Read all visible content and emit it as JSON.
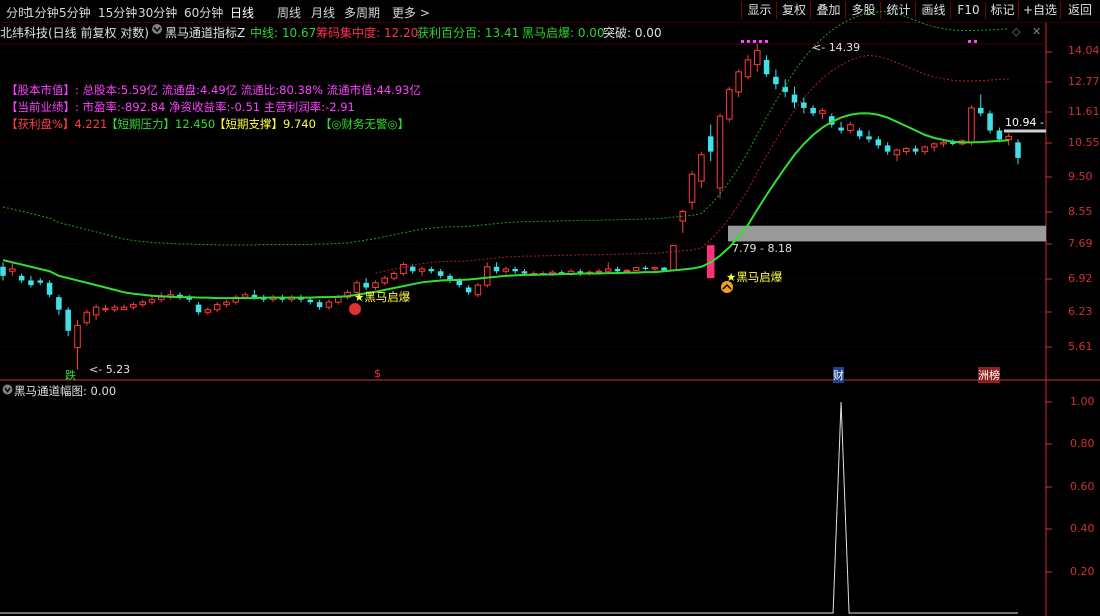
{
  "toolbar": {
    "tabs": [
      "分时",
      "1分钟",
      "5分钟",
      "15分钟",
      "30分钟",
      "60分钟",
      "日线",
      "周线",
      "月线",
      "多周期",
      "更多 >"
    ],
    "active_tab": "日线",
    "right_buttons": [
      "显示",
      "复权",
      "叠加",
      "多股",
      "统计",
      "画线",
      "F10",
      "标记",
      "+自选",
      "返回"
    ]
  },
  "header": {
    "stock": "北纬科技(日线 前复权 对数)",
    "indicator": "黑马通道指标Z",
    "fields": [
      {
        "label": "中线:",
        "value": "10.67",
        "color": "#30d030"
      },
      {
        "label": "筹码集中度:",
        "value": "12.20",
        "color": "#ff3050"
      },
      {
        "label": "获利百分百:",
        "value": "13.41",
        "color": "#30d030"
      },
      {
        "label": "黑马启爆:",
        "value": "0.00",
        "color": "#30d030"
      },
      {
        "label": "突破:",
        "value": "0.00",
        "color": "#e0e0e0"
      }
    ]
  },
  "info": {
    "line1": "【股本市值】: 总股本:5.59亿 流通盘:4.49亿 流通比:80.38% 流通市值:44.93亿",
    "line2": "【当前业绩】: 市盈率:-892.84 净资收益率:-0.51 主营利润率:-2.91",
    "line3_a": "【获利盘%】4.221",
    "line3_b": "【短期压力】12.450",
    "line3_c": "【短期支撑】9.740",
    "line3_d": "【◎财务无警◎】"
  },
  "annotations": {
    "high": "14.39",
    "low": "5.23",
    "range": "7.79 - 8.18",
    "current_tag": "10.94",
    "signal1": "黑马启爆",
    "signal2": "黑马启爆",
    "mark_die": "跌",
    "mark_s": "$",
    "mark_cai": "财",
    "mark_bang": "洲榜"
  },
  "price_axis": [
    "14.04",
    "12.77",
    "11.61",
    "10.55",
    "9.50",
    "8.55",
    "7.69",
    "6.92",
    "6.23",
    "5.61"
  ],
  "lower_panel": {
    "title": "黑马通道幅图",
    "value": ": 0.00",
    "axis": [
      "1.00",
      "0.80",
      "0.60",
      "0.40",
      "0.20"
    ]
  },
  "colors": {
    "up": "#ff3b3b",
    "down": "#40e0e8",
    "ma": "#30e030",
    "axis": "#d03030",
    "magenta": "#ff40ff"
  },
  "chart_data": {
    "type": "candlestick",
    "candles": [
      {
        "o": 7.2,
        "h": 7.3,
        "l": 6.9,
        "c": 7.0
      },
      {
        "o": 7.1,
        "h": 7.3,
        "l": 7.0,
        "c": 7.15
      },
      {
        "o": 7.0,
        "h": 7.05,
        "l": 6.85,
        "c": 6.9
      },
      {
        "o": 6.9,
        "h": 7.0,
        "l": 6.75,
        "c": 6.8
      },
      {
        "o": 6.9,
        "h": 6.95,
        "l": 6.8,
        "c": 6.85
      },
      {
        "o": 6.85,
        "h": 6.9,
        "l": 6.55,
        "c": 6.6
      },
      {
        "o": 6.55,
        "h": 6.6,
        "l": 6.2,
        "c": 6.3
      },
      {
        "o": 6.3,
        "h": 6.35,
        "l": 5.8,
        "c": 5.9
      },
      {
        "o": 5.6,
        "h": 6.1,
        "l": 5.23,
        "c": 6.0
      },
      {
        "o": 6.05,
        "h": 6.3,
        "l": 6.0,
        "c": 6.25
      },
      {
        "o": 6.2,
        "h": 6.4,
        "l": 6.1,
        "c": 6.35
      },
      {
        "o": 6.3,
        "h": 6.4,
        "l": 6.25,
        "c": 6.32
      },
      {
        "o": 6.3,
        "h": 6.4,
        "l": 6.25,
        "c": 6.35
      },
      {
        "o": 6.3,
        "h": 6.4,
        "l": 6.3,
        "c": 6.35
      },
      {
        "o": 6.35,
        "h": 6.45,
        "l": 6.3,
        "c": 6.4
      },
      {
        "o": 6.4,
        "h": 6.5,
        "l": 6.35,
        "c": 6.45
      },
      {
        "o": 6.45,
        "h": 6.6,
        "l": 6.4,
        "c": 6.5
      },
      {
        "o": 6.5,
        "h": 6.65,
        "l": 6.45,
        "c": 6.55
      },
      {
        "o": 6.55,
        "h": 6.7,
        "l": 6.5,
        "c": 6.6
      },
      {
        "o": 6.6,
        "h": 6.65,
        "l": 6.5,
        "c": 6.55
      },
      {
        "o": 6.55,
        "h": 6.6,
        "l": 6.45,
        "c": 6.5
      },
      {
        "o": 6.4,
        "h": 6.45,
        "l": 6.2,
        "c": 6.25
      },
      {
        "o": 6.25,
        "h": 6.35,
        "l": 6.2,
        "c": 6.3
      },
      {
        "o": 6.3,
        "h": 6.45,
        "l": 6.25,
        "c": 6.4
      },
      {
        "o": 6.4,
        "h": 6.5,
        "l": 6.35,
        "c": 6.45
      },
      {
        "o": 6.45,
        "h": 6.6,
        "l": 6.4,
        "c": 6.55
      },
      {
        "o": 6.55,
        "h": 6.65,
        "l": 6.5,
        "c": 6.6
      },
      {
        "o": 6.6,
        "h": 6.7,
        "l": 6.5,
        "c": 6.55
      },
      {
        "o": 6.55,
        "h": 6.6,
        "l": 6.45,
        "c": 6.5
      },
      {
        "o": 6.5,
        "h": 6.6,
        "l": 6.45,
        "c": 6.55
      },
      {
        "o": 6.55,
        "h": 6.6,
        "l": 6.45,
        "c": 6.5
      },
      {
        "o": 6.5,
        "h": 6.6,
        "l": 6.45,
        "c": 6.55
      },
      {
        "o": 6.55,
        "h": 6.6,
        "l": 6.45,
        "c": 6.5
      },
      {
        "o": 6.5,
        "h": 6.55,
        "l": 6.4,
        "c": 6.45
      },
      {
        "o": 6.45,
        "h": 6.5,
        "l": 6.3,
        "c": 6.35
      },
      {
        "o": 6.35,
        "h": 6.5,
        "l": 6.3,
        "c": 6.45
      },
      {
        "o": 6.45,
        "h": 6.6,
        "l": 6.4,
        "c": 6.55
      },
      {
        "o": 6.55,
        "h": 6.7,
        "l": 6.5,
        "c": 6.65
      },
      {
        "o": 6.65,
        "h": 6.9,
        "l": 6.6,
        "c": 6.85
      },
      {
        "o": 6.85,
        "h": 6.95,
        "l": 6.7,
        "c": 6.75
      },
      {
        "o": 6.75,
        "h": 6.9,
        "l": 6.7,
        "c": 6.85
      },
      {
        "o": 6.85,
        "h": 7.0,
        "l": 6.8,
        "c": 6.95
      },
      {
        "o": 6.95,
        "h": 7.1,
        "l": 6.9,
        "c": 7.05
      },
      {
        "o": 7.05,
        "h": 7.3,
        "l": 7.0,
        "c": 7.25
      },
      {
        "o": 7.2,
        "h": 7.25,
        "l": 7.05,
        "c": 7.1
      },
      {
        "o": 7.1,
        "h": 7.2,
        "l": 7.0,
        "c": 7.15
      },
      {
        "o": 7.15,
        "h": 7.2,
        "l": 7.05,
        "c": 7.1
      },
      {
        "o": 7.1,
        "h": 7.15,
        "l": 6.95,
        "c": 7.0
      },
      {
        "o": 7.0,
        "h": 7.05,
        "l": 6.85,
        "c": 6.9
      },
      {
        "o": 6.9,
        "h": 6.95,
        "l": 6.75,
        "c": 6.8
      },
      {
        "o": 6.75,
        "h": 6.8,
        "l": 6.6,
        "c": 6.65
      },
      {
        "o": 6.6,
        "h": 6.85,
        "l": 6.55,
        "c": 6.8
      },
      {
        "o": 6.8,
        "h": 7.3,
        "l": 6.75,
        "c": 7.2
      },
      {
        "o": 7.2,
        "h": 7.3,
        "l": 7.05,
        "c": 7.1
      },
      {
        "o": 7.1,
        "h": 7.2,
        "l": 7.05,
        "c": 7.15
      },
      {
        "o": 7.15,
        "h": 7.2,
        "l": 7.05,
        "c": 7.1
      },
      {
        "o": 7.1,
        "h": 7.15,
        "l": 7.0,
        "c": 7.05
      },
      {
        "o": 7.05,
        "h": 7.1,
        "l": 7.0,
        "c": 7.05
      },
      {
        "o": 7.05,
        "h": 7.1,
        "l": 7.0,
        "c": 7.05
      },
      {
        "o": 7.05,
        "h": 7.12,
        "l": 7.0,
        "c": 7.08
      },
      {
        "o": 7.08,
        "h": 7.12,
        "l": 7.02,
        "c": 7.05
      },
      {
        "o": 7.05,
        "h": 7.15,
        "l": 7.0,
        "c": 7.1
      },
      {
        "o": 7.1,
        "h": 7.15,
        "l": 7.0,
        "c": 7.05
      },
      {
        "o": 7.05,
        "h": 7.12,
        "l": 7.0,
        "c": 7.08
      },
      {
        "o": 7.08,
        "h": 7.15,
        "l": 7.05,
        "c": 7.1
      },
      {
        "o": 7.1,
        "h": 7.3,
        "l": 7.05,
        "c": 7.15
      },
      {
        "o": 7.15,
        "h": 7.2,
        "l": 7.05,
        "c": 7.1
      },
      {
        "o": 7.1,
        "h": 7.15,
        "l": 7.05,
        "c": 7.12
      },
      {
        "o": 7.12,
        "h": 7.2,
        "l": 7.1,
        "c": 7.18
      },
      {
        "o": 7.18,
        "h": 7.22,
        "l": 7.12,
        "c": 7.15
      },
      {
        "o": 7.15,
        "h": 7.2,
        "l": 7.1,
        "c": 7.18
      },
      {
        "o": 7.18,
        "h": 7.2,
        "l": 7.1,
        "c": 7.12
      },
      {
        "o": 7.12,
        "h": 7.7,
        "l": 7.1,
        "c": 7.69
      },
      {
        "o": 8.3,
        "h": 8.6,
        "l": 8.0,
        "c": 8.55
      },
      {
        "o": 8.8,
        "h": 9.7,
        "l": 8.6,
        "c": 9.6
      },
      {
        "o": 9.4,
        "h": 10.3,
        "l": 9.2,
        "c": 10.2
      },
      {
        "o": 10.8,
        "h": 11.2,
        "l": 10.0,
        "c": 10.3
      },
      {
        "o": 9.2,
        "h": 11.6,
        "l": 8.9,
        "c": 11.5
      },
      {
        "o": 11.4,
        "h": 12.6,
        "l": 11.3,
        "c": 12.5
      },
      {
        "o": 12.4,
        "h": 13.3,
        "l": 12.2,
        "c": 13.2
      },
      {
        "o": 13.0,
        "h": 13.9,
        "l": 12.9,
        "c": 13.7
      },
      {
        "o": 13.5,
        "h": 14.39,
        "l": 13.2,
        "c": 14.1
      },
      {
        "o": 13.7,
        "h": 13.9,
        "l": 13.0,
        "c": 13.1
      },
      {
        "o": 13.0,
        "h": 13.3,
        "l": 12.5,
        "c": 12.7
      },
      {
        "o": 12.6,
        "h": 12.9,
        "l": 12.2,
        "c": 12.4
      },
      {
        "o": 12.3,
        "h": 12.6,
        "l": 11.8,
        "c": 12.0
      },
      {
        "o": 12.0,
        "h": 12.2,
        "l": 11.6,
        "c": 11.8
      },
      {
        "o": 11.8,
        "h": 11.9,
        "l": 11.5,
        "c": 11.6
      },
      {
        "o": 11.6,
        "h": 11.8,
        "l": 11.4,
        "c": 11.7
      },
      {
        "o": 11.5,
        "h": 11.6,
        "l": 11.1,
        "c": 11.2
      },
      {
        "o": 11.1,
        "h": 11.3,
        "l": 10.9,
        "c": 11.0
      },
      {
        "o": 11.0,
        "h": 11.3,
        "l": 10.9,
        "c": 11.2
      },
      {
        "o": 11.0,
        "h": 11.1,
        "l": 10.7,
        "c": 10.8
      },
      {
        "o": 10.8,
        "h": 11.0,
        "l": 10.6,
        "c": 10.7
      },
      {
        "o": 10.7,
        "h": 10.8,
        "l": 10.4,
        "c": 10.5
      },
      {
        "o": 10.5,
        "h": 10.6,
        "l": 10.2,
        "c": 10.3
      },
      {
        "o": 10.2,
        "h": 10.4,
        "l": 10.0,
        "c": 10.35
      },
      {
        "o": 10.3,
        "h": 10.45,
        "l": 10.2,
        "c": 10.4
      },
      {
        "o": 10.4,
        "h": 10.5,
        "l": 10.2,
        "c": 10.3
      },
      {
        "o": 10.3,
        "h": 10.5,
        "l": 10.2,
        "c": 10.45
      },
      {
        "o": 10.45,
        "h": 10.6,
        "l": 10.3,
        "c": 10.55
      },
      {
        "o": 10.55,
        "h": 10.7,
        "l": 10.45,
        "c": 10.6
      },
      {
        "o": 10.6,
        "h": 10.7,
        "l": 10.5,
        "c": 10.55
      },
      {
        "o": 10.55,
        "h": 10.7,
        "l": 10.5,
        "c": 10.65
      },
      {
        "o": 10.6,
        "h": 11.9,
        "l": 10.5,
        "c": 11.8
      },
      {
        "o": 11.8,
        "h": 12.3,
        "l": 11.5,
        "c": 11.6
      },
      {
        "o": 11.6,
        "h": 11.7,
        "l": 10.9,
        "c": 11.0
      },
      {
        "o": 11.0,
        "h": 11.1,
        "l": 10.6,
        "c": 10.7
      },
      {
        "o": 10.7,
        "h": 10.9,
        "l": 10.5,
        "c": 10.8
      },
      {
        "o": 10.6,
        "h": 10.7,
        "l": 9.9,
        "c": 10.1
      }
    ],
    "ma": [
      7.35,
      7.3,
      7.25,
      7.2,
      7.15,
      7.1,
      7.0,
      6.95,
      6.9,
      6.85,
      6.8,
      6.75,
      6.7,
      6.65,
      6.62,
      6.6,
      6.58,
      6.57,
      6.56,
      6.55,
      6.55,
      6.54,
      6.54,
      6.53,
      6.53,
      6.53,
      6.53,
      6.53,
      6.54,
      6.54,
      6.54,
      6.54,
      6.54,
      6.54,
      6.55,
      6.55,
      6.56,
      6.57,
      6.6,
      6.63,
      6.66,
      6.7,
      6.74,
      6.78,
      6.82,
      6.86,
      6.88,
      6.9,
      6.91,
      6.91,
      6.92,
      6.94,
      6.96,
      6.98,
      7.0,
      7.01,
      7.02,
      7.02,
      7.03,
      7.03,
      7.04,
      7.04,
      7.05,
      7.05,
      7.05,
      7.06,
      7.06,
      7.07,
      7.07,
      7.08,
      7.08,
      7.1,
      7.12,
      7.14,
      7.16,
      7.2,
      7.3,
      7.45,
      7.65,
      7.9,
      8.2,
      8.6,
      9.0,
      9.4,
      9.8,
      10.2,
      10.55,
      10.85,
      11.1,
      11.3,
      11.45,
      11.55,
      11.6,
      11.6,
      11.55,
      11.45,
      11.3,
      11.15,
      11.0,
      10.85,
      10.75,
      10.68,
      10.62,
      10.6,
      10.6,
      10.61,
      10.63,
      10.65,
      10.67
    ],
    "lower_series": {
      "x": [
        "bar 90"
      ],
      "values": [
        1.0
      ]
    }
  }
}
